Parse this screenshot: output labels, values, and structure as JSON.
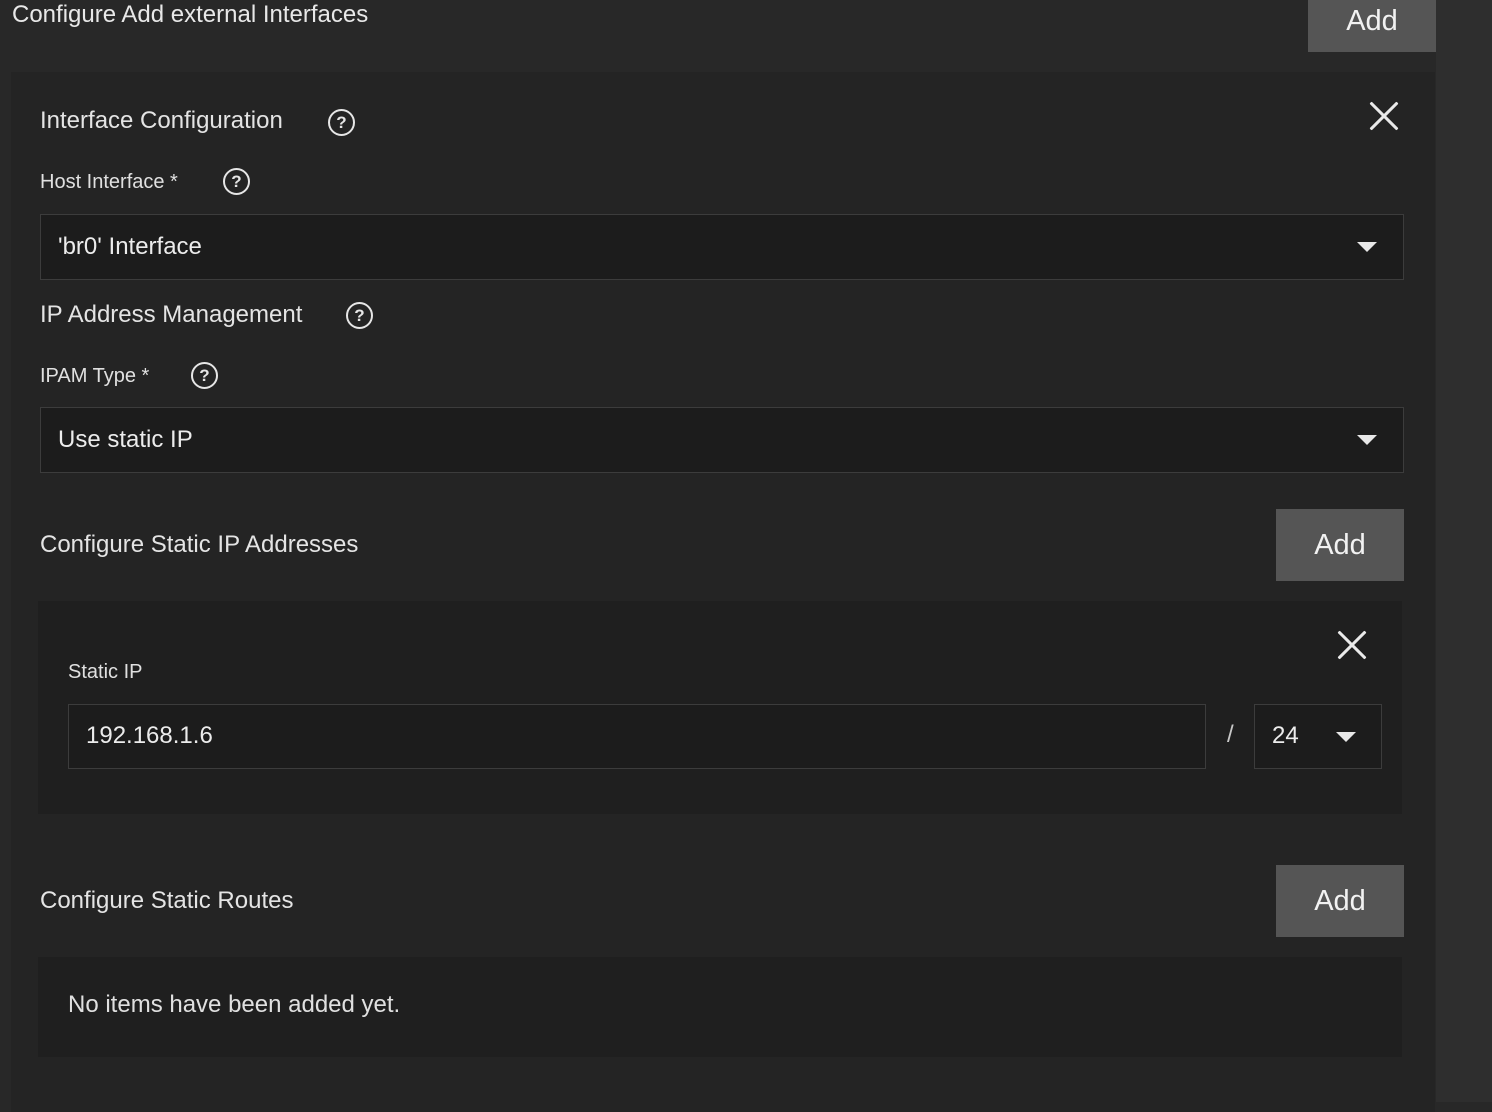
{
  "top": {
    "title": "Configure Add external Interfaces",
    "add_label": "Add"
  },
  "interface_config": {
    "title": "Interface Configuration",
    "help_icon": "help-circle-icon",
    "close_icon": "close-icon",
    "host_interface": {
      "label": "Host Interface *",
      "value": "'br0' Interface"
    }
  },
  "ipam": {
    "title": "IP Address Management",
    "type_label": "IPAM Type *",
    "type_value": "Use static IP"
  },
  "static_ips": {
    "title": "Configure Static IP Addresses",
    "add_label": "Add",
    "item": {
      "label": "Static IP",
      "ip_value": "192.168.1.6",
      "separator": "/",
      "prefix_value": "24"
    }
  },
  "static_routes": {
    "title": "Configure Static Routes",
    "add_label": "Add",
    "empty_text": "No items have been added yet."
  },
  "colors": {
    "background": "#282828",
    "panel": "#242424",
    "subpanel": "#1f1f1f",
    "button": "#555555",
    "input": "#1c1c1c"
  }
}
